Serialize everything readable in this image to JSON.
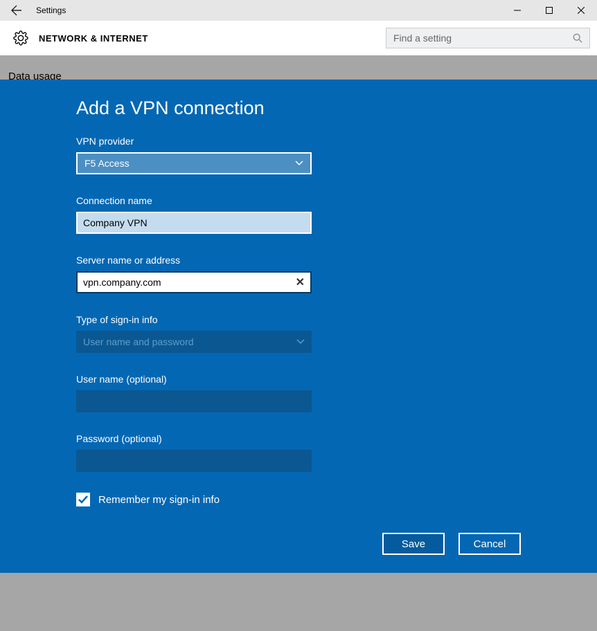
{
  "titlebar": {
    "title": "Settings"
  },
  "subheader": {
    "section": "NETWORK & INTERNET",
    "search_placeholder": "Find a setting"
  },
  "sidebar": {
    "items": [
      {
        "label": "Data usage"
      }
    ]
  },
  "dialog": {
    "title": "Add a VPN connection",
    "fields": {
      "provider": {
        "label": "VPN provider",
        "value": "F5 Access"
      },
      "connection": {
        "label": "Connection name",
        "value": "Company VPN"
      },
      "server": {
        "label": "Server name or address",
        "value": "vpn.company.com"
      },
      "signin": {
        "label": "Type of sign-in info",
        "value": "User name and password"
      },
      "username": {
        "label": "User name (optional)",
        "value": ""
      },
      "password": {
        "label": "Password (optional)",
        "value": ""
      }
    },
    "remember": {
      "label": "Remember my sign-in info",
      "checked": true
    },
    "buttons": {
      "save": "Save",
      "cancel": "Cancel"
    }
  }
}
